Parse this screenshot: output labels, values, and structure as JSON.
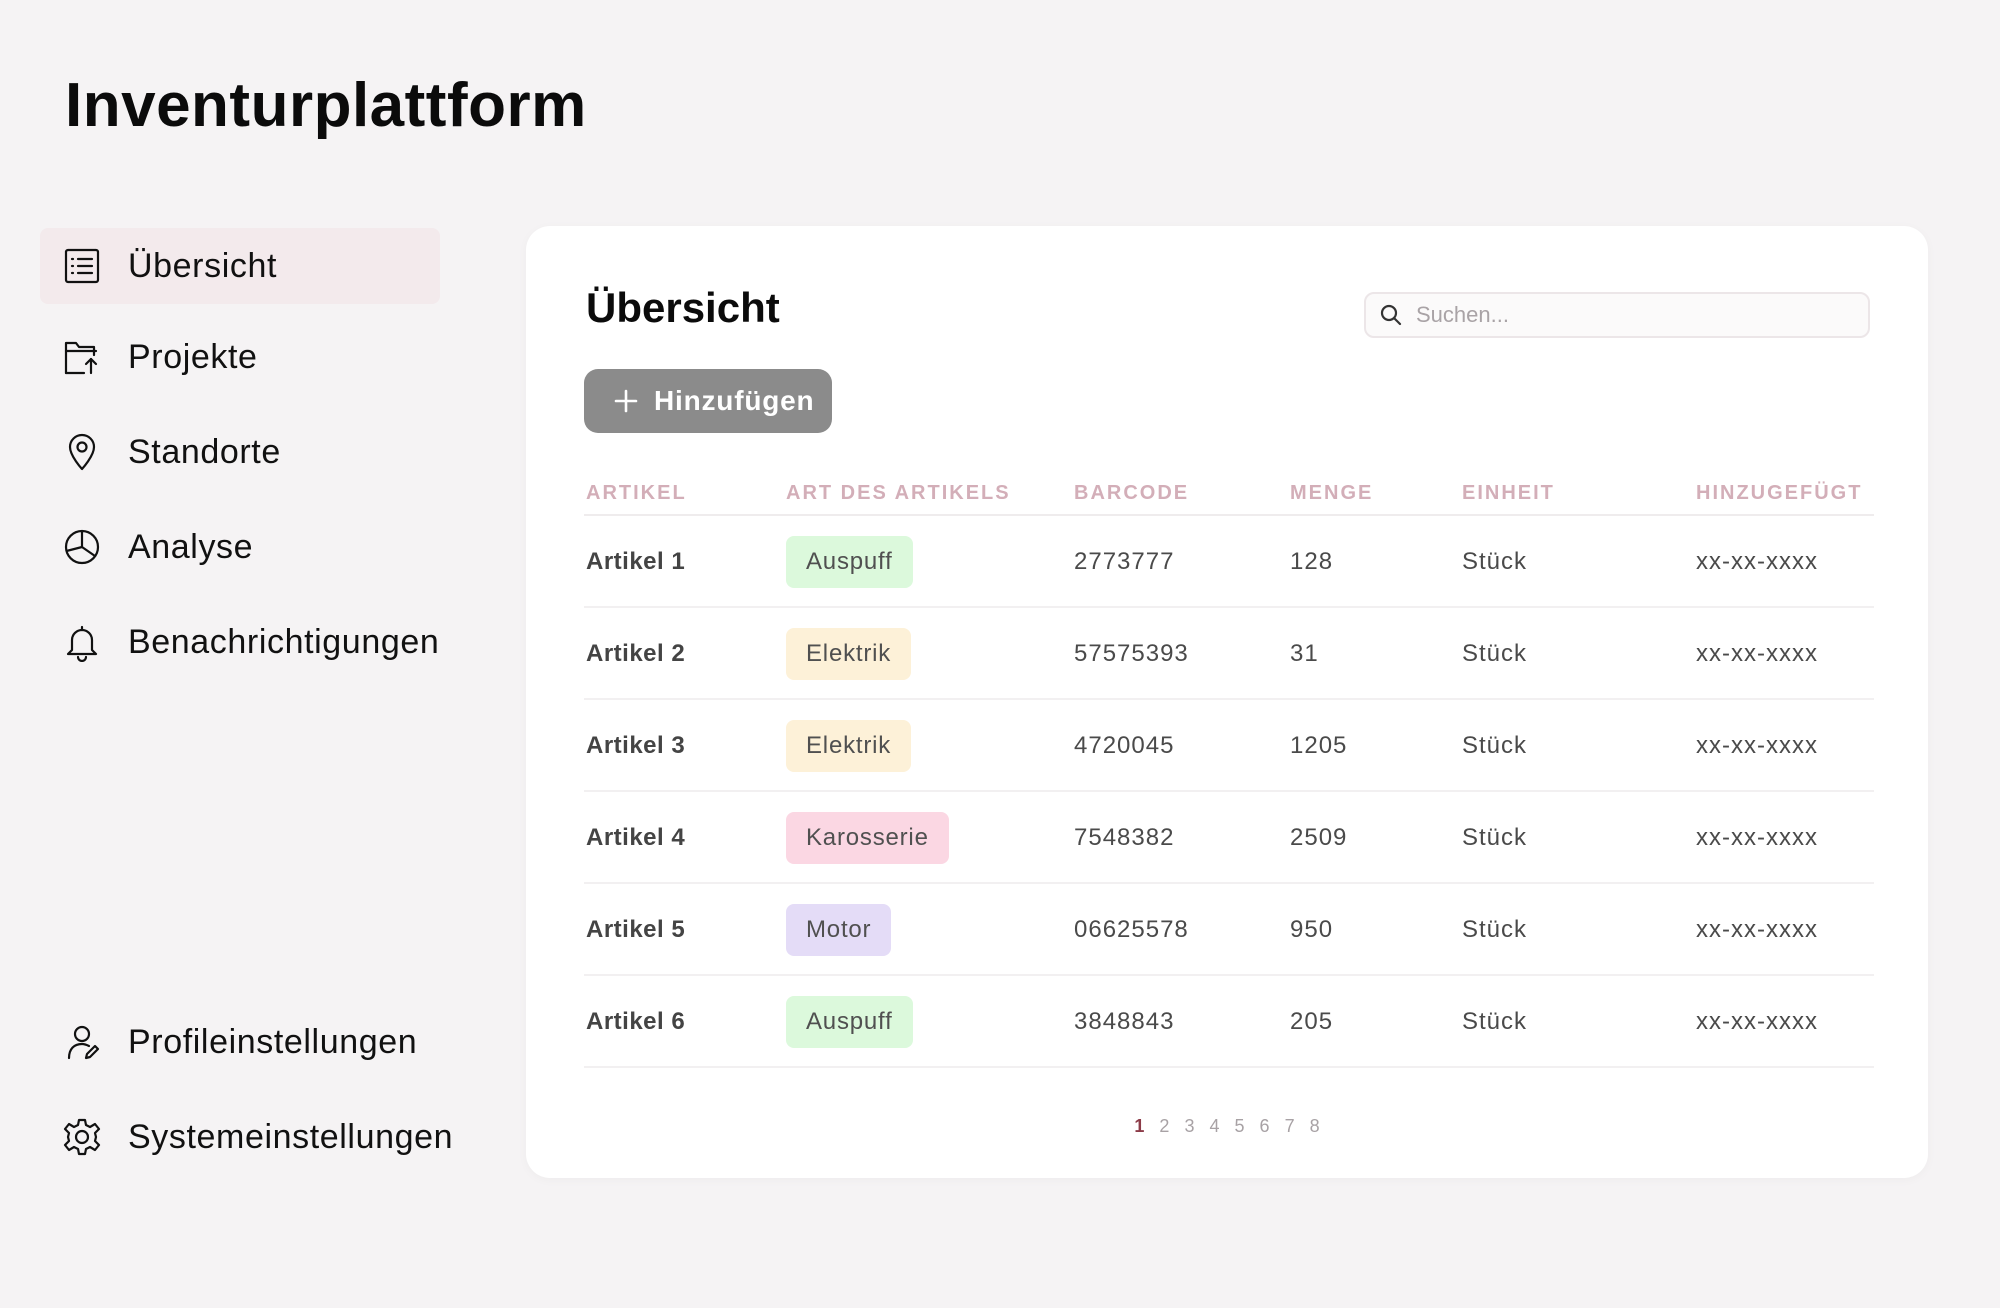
{
  "app": {
    "title": "Inventurplattform"
  },
  "sidebar": {
    "items": [
      {
        "label": "Übersicht",
        "icon": "list-icon",
        "active": true
      },
      {
        "label": "Projekte",
        "icon": "folder-upload-icon"
      },
      {
        "label": "Standorte",
        "icon": "location-pin-icon"
      },
      {
        "label": "Analyse",
        "icon": "pie-chart-icon"
      },
      {
        "label": "Benachrichtigungen",
        "icon": "bell-icon"
      }
    ],
    "bottom_items": [
      {
        "label": "Profileinstellungen",
        "icon": "user-edit-icon"
      },
      {
        "label": "Systemeinstellungen",
        "icon": "gear-icon"
      }
    ]
  },
  "main": {
    "title": "Übersicht",
    "search": {
      "placeholder": "Suchen..."
    },
    "add_button": {
      "label": "Hinzufügen"
    },
    "table": {
      "columns": [
        "Artikel",
        "Art des Artikels",
        "Barcode",
        "Menge",
        "Einheit",
        "Hinzugefügt"
      ],
      "rows": [
        {
          "article": "Artikel 1",
          "type": "Auspuff",
          "barcode": "2773777",
          "quantity": "128",
          "unit": "Stück",
          "added": "xx-xx-xxxx"
        },
        {
          "article": "Artikel 2",
          "type": "Elektrik",
          "barcode": "57575393",
          "quantity": "31",
          "unit": "Stück",
          "added": "xx-xx-xxxx"
        },
        {
          "article": "Artikel 3",
          "type": "Elektrik",
          "barcode": "4720045",
          "quantity": "1205",
          "unit": "Stück",
          "added": "xx-xx-xxxx"
        },
        {
          "article": "Artikel 4",
          "type": "Karosserie",
          "barcode": "7548382",
          "quantity": "2509",
          "unit": "Stück",
          "added": "xx-xx-xxxx"
        },
        {
          "article": "Artikel 5",
          "type": "Motor",
          "barcode": "06625578",
          "quantity": "950",
          "unit": "Stück",
          "added": "xx-xx-xxxx"
        },
        {
          "article": "Artikel 6",
          "type": "Auspuff",
          "barcode": "3848843",
          "quantity": "205",
          "unit": "Stück",
          "added": "xx-xx-xxxx"
        }
      ]
    },
    "pagination": {
      "pages": [
        "1",
        "2",
        "3",
        "4",
        "5",
        "6",
        "7",
        "8"
      ],
      "current": "1"
    }
  },
  "colors": {
    "background": "#f5f3f4",
    "active_item": "#f3eaec",
    "header_text": "#d3aeb8",
    "button": "#8b8b8b",
    "badge_auspuff": "#dcf9dc",
    "badge_elektrik": "#fdf1d8",
    "badge_karosserie": "#fbd7e3",
    "badge_motor": "#e4dcf7",
    "pagination_active": "#8c3b48"
  }
}
